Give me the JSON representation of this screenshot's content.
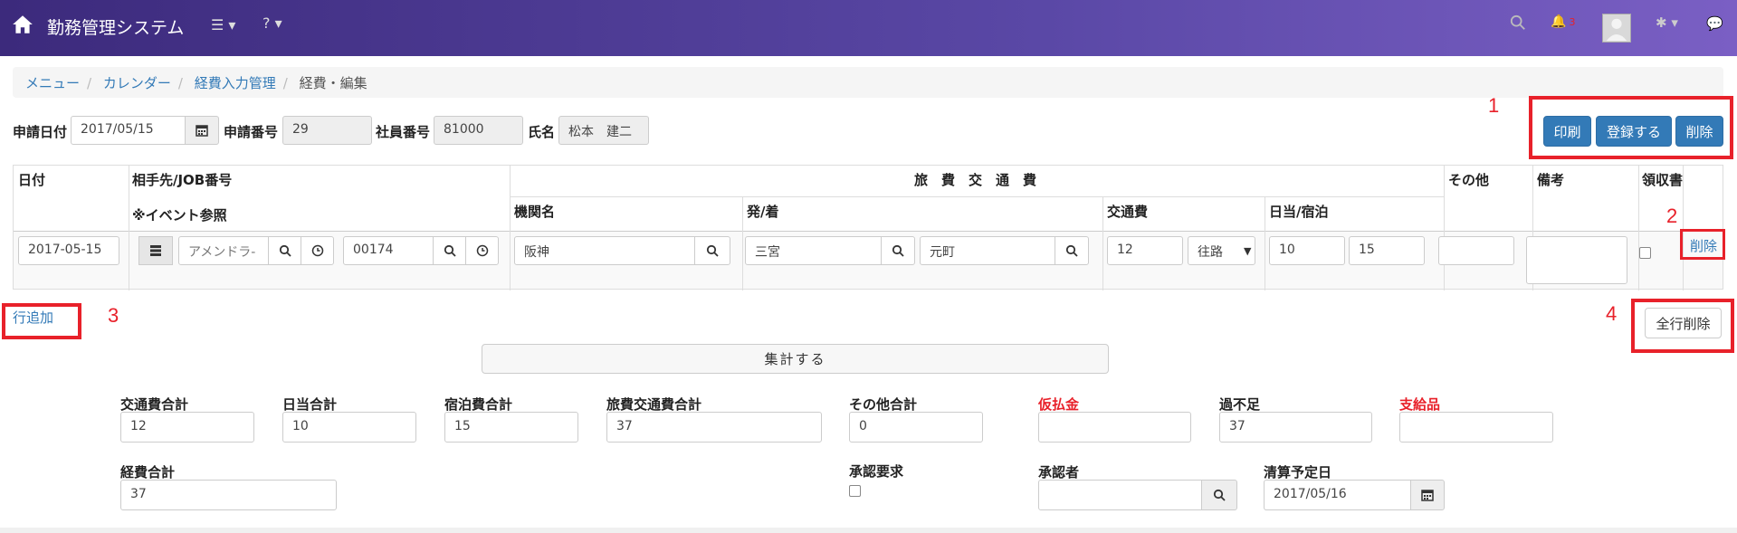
{
  "navbar": {
    "brand": "勤務管理システム",
    "menu_icon": "list-icon",
    "help_icon": "question-icon",
    "bell_count": "3"
  },
  "breadcrumb": {
    "items": [
      "メニュー",
      "カレンダー",
      "経費入力管理"
    ],
    "active": "経費・編集"
  },
  "header": {
    "date_label": "申請日付",
    "date_value": "2017/05/15",
    "appno_label": "申請番号",
    "appno_value": "29",
    "empno_label": "社員番号",
    "empno_value": "81000",
    "name_label": "氏名",
    "name_value": "松本　建二"
  },
  "actions": {
    "print": "印刷",
    "register": "登録する",
    "delete": "削除"
  },
  "annotations": {
    "n1": "1",
    "n2": "2",
    "n3": "3",
    "n4": "4"
  },
  "table": {
    "headers": {
      "date": "日付",
      "partner": "相手先/JOB番号",
      "event_ref": "※イベント参照",
      "travel": "旅　費　交　通　費",
      "org": "機関名",
      "route": "発/着",
      "fare": "交通費",
      "daily": "日当/宿泊",
      "other": "その他",
      "note": "備考",
      "receipt": "領収書"
    },
    "row": {
      "date": "2017-05-15",
      "partner": "アメンドラ-",
      "job": "00174",
      "org": "阪神",
      "from": "三宮",
      "to": "元町",
      "fare": "12",
      "trip": "往路",
      "daily": "10",
      "lodging": "15",
      "other": "",
      "note": "",
      "delete": "削除"
    }
  },
  "add_row": "行追加",
  "delete_all": "全行削除",
  "calc_button": "集計する",
  "summary": {
    "fare_total_label": "交通費合計",
    "fare_total": "12",
    "daily_total_label": "日当合計",
    "daily_total": "10",
    "lodging_total_label": "宿泊費合計",
    "lodging_total": "15",
    "travel_total_label": "旅費交通費合計",
    "travel_total": "37",
    "other_total_label": "その他合計",
    "other_total": "0",
    "advance_label": "仮払金",
    "advance": "",
    "balance_label": "過不足",
    "balance": "37",
    "payment_label": "支給品",
    "payment": "",
    "expense_total_label": "経費合計",
    "expense_total": "37",
    "approval_req_label": "承認要求",
    "approver_label": "承認者",
    "approver": "",
    "settle_date_label": "清算予定日",
    "settle_date": "2017/05/16"
  },
  "colors": {
    "accent": "#337ab7",
    "annotation": "#e8212a"
  }
}
